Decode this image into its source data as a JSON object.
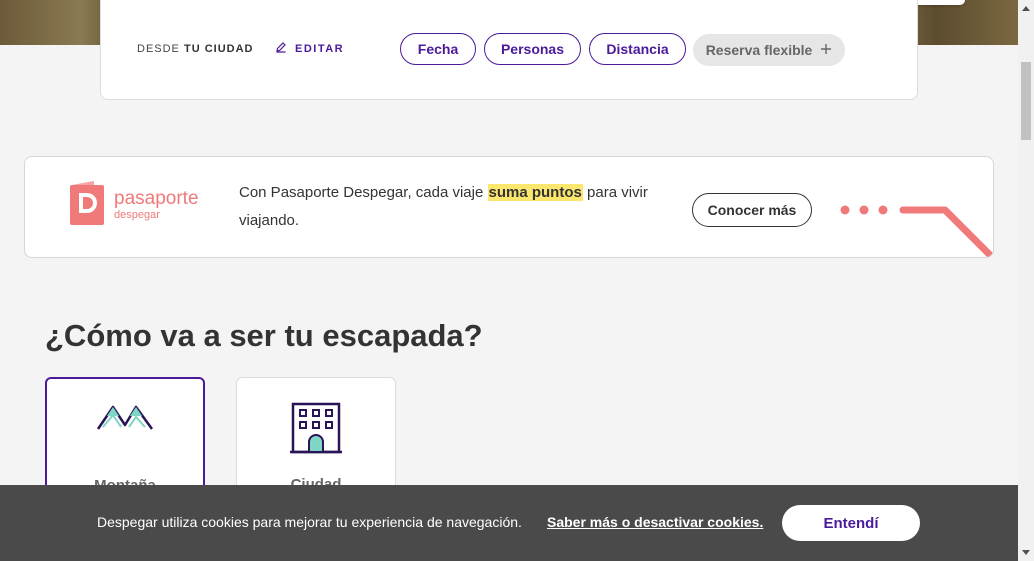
{
  "filters": {
    "desde_prefix": "DESDE",
    "desde_city": "TU CIUDAD",
    "edit_label": "EDITAR",
    "pills": [
      "Fecha",
      "Personas",
      "Distancia"
    ],
    "flexible_label": "Reserva flexible"
  },
  "pasaporte": {
    "logo_title": "pasaporte",
    "logo_sub": "despegar",
    "text_before": "Con Pasaporte Despegar, cada viaje ",
    "text_highlight": "suma puntos",
    "text_after": " para vivir viajando.",
    "cta_label": "Conocer más"
  },
  "section": {
    "title": "¿Cómo va a ser tu escapada?",
    "types": [
      {
        "label": "Montaña",
        "icon": "mountain-icon",
        "selected": true
      },
      {
        "label": "Ciudad",
        "icon": "building-icon",
        "selected": false
      }
    ]
  },
  "cookies": {
    "text": "Despegar utiliza cookies para mejorar tu experiencia de navegación.",
    "link_label": "Saber más o desactivar cookies.",
    "accept_label": "Entendí"
  },
  "colors": {
    "brand_purple": "#4b1a9a",
    "coral": "#f07a7a",
    "highlight": "#fbe66e",
    "cookie_bg": "#4a4a4a"
  }
}
